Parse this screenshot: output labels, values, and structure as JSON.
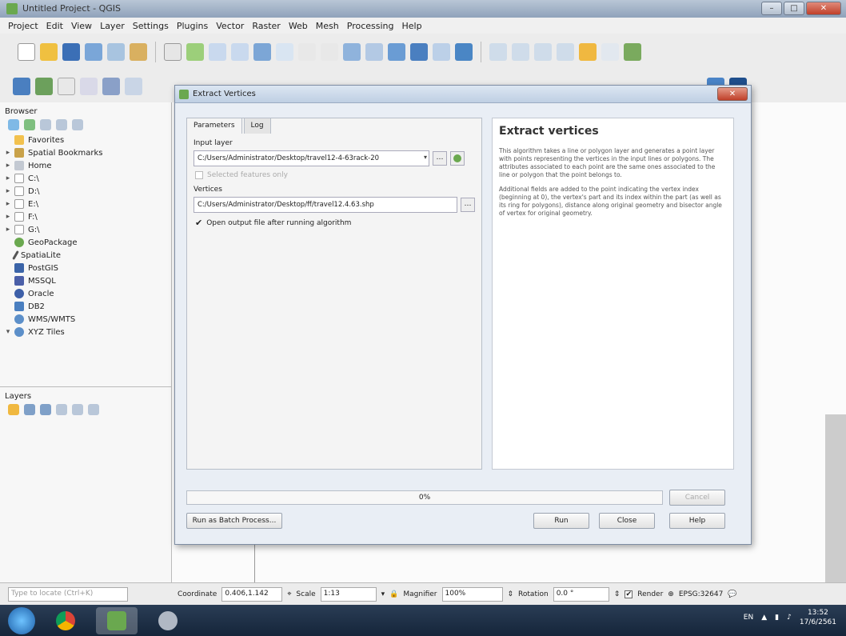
{
  "window": {
    "title": "Untitled Project - QGIS"
  },
  "menu": [
    "Project",
    "Edit",
    "View",
    "Layer",
    "Settings",
    "Plugins",
    "Vector",
    "Raster",
    "Web",
    "Mesh",
    "Processing",
    "Help"
  ],
  "browser": {
    "title": "Browser",
    "items": [
      {
        "label": "Favorites"
      },
      {
        "label": "Spatial Bookmarks"
      },
      {
        "label": "Home"
      },
      {
        "label": "C:\\"
      },
      {
        "label": "D:\\"
      },
      {
        "label": "E:\\"
      },
      {
        "label": "F:\\"
      },
      {
        "label": "G:\\"
      },
      {
        "label": "GeoPackage"
      },
      {
        "label": "SpatiaLite"
      },
      {
        "label": "PostGIS"
      },
      {
        "label": "MSSQL"
      },
      {
        "label": "Oracle"
      },
      {
        "label": "DB2"
      },
      {
        "label": "WMS/WMTS"
      },
      {
        "label": "XYZ Tiles"
      }
    ]
  },
  "layers": {
    "title": "Layers"
  },
  "dialog": {
    "title": "Extract Vertices",
    "tabs": [
      "Parameters",
      "Log"
    ],
    "input_layer_label": "Input layer",
    "input_layer_value": "C:/Users/Administrator/Desktop/travel12-4-63rack-20",
    "selected_only": "Selected features only",
    "vertices_label": "Vertices",
    "vertices_value": "C:/Users/Administrator/Desktop/ff/travel12.4.63.shp",
    "open_output": "Open output file after running algorithm",
    "help_title": "Extract vertices",
    "help_p1": "This algorithm takes a line or polygon layer and generates a point layer with points representing the vertices in the input lines or polygons. The attributes associated to each point are the same ones associated to the line or polygon that the point belongs to.",
    "help_p2": "Additional fields are added to the point indicating the vertex index (beginning at 0), the vertex's part and its index within the part (as well as its ring for polygons), distance along original geometry and bisector angle of vertex for original geometry.",
    "progress": "0%",
    "cancel": "Cancel",
    "batch": "Run as Batch Process...",
    "run": "Run",
    "close": "Close",
    "help": "Help"
  },
  "status": {
    "search_placeholder": "Type to locate (Ctrl+K)",
    "coordinate_label": "Coordinate",
    "coordinate_value": "0.406,1.142",
    "scale_label": "Scale",
    "scale_value": "1:13",
    "magnifier_label": "Magnifier",
    "magnifier_value": "100%",
    "rotation_label": "Rotation",
    "rotation_value": "0.0 °",
    "render_label": "Render",
    "crs": "EPSG:32647"
  },
  "taskbar": {
    "lang": "EN",
    "time": "13:52",
    "date": "17/6/2561"
  }
}
